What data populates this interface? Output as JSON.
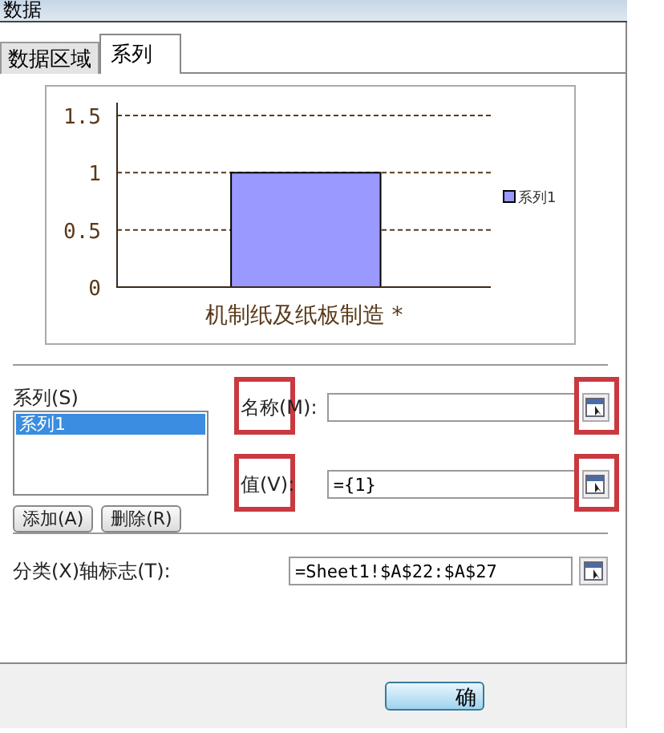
{
  "window": {
    "title": "数据"
  },
  "tabs": [
    {
      "label": "数据区域",
      "selected": false
    },
    {
      "label": "系列",
      "selected": true
    }
  ],
  "chart": {
    "chart_data": {
      "type": "bar",
      "categories": [
        "机制纸及纸板制造 *"
      ],
      "series": [
        {
          "name": "系列1",
          "color": "#9999ff",
          "values": [
            1
          ]
        }
      ],
      "ylim": [
        0,
        1.5
      ],
      "yticks": [
        {
          "value": 0,
          "label": "0"
        },
        {
          "value": 0.5,
          "label": "0.5"
        },
        {
          "value": 1,
          "label": "1"
        },
        {
          "value": 1.5,
          "label": "1.5"
        }
      ]
    }
  },
  "series_list": {
    "label": "系列(S)",
    "items": [
      {
        "label": "系列1",
        "selected": true
      }
    ]
  },
  "series_buttons": [
    "添加(A)",
    "删除(R)"
  ],
  "fields": [
    {
      "label": "名称(M):",
      "highlight": true
    },
    {
      "label": "值(V):",
      "value": "={1}",
      "highlight": true
    }
  ],
  "category_field": {
    "label": "分类(X)轴标志(T):",
    "value": "=Sheet1!$A$22:$A$27",
    "highlight": false
  },
  "footer_buttons": [
    "确"
  ]
}
